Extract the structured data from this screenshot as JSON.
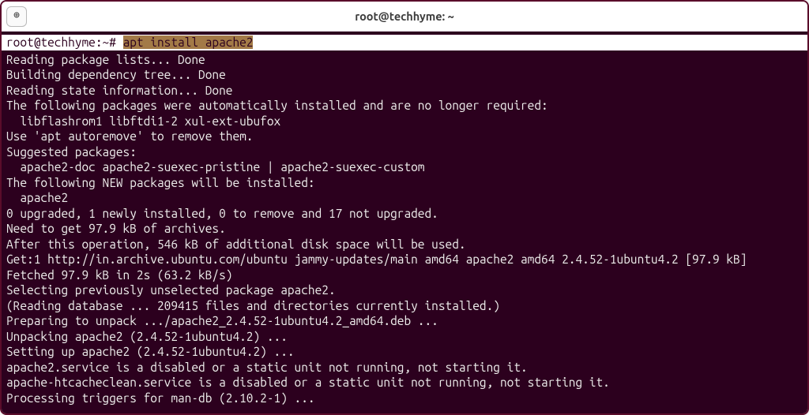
{
  "window": {
    "title": "root@techhyme: ~"
  },
  "titlebar": {
    "new_tab_label": "⊕"
  },
  "terminal": {
    "prompt": "root@techhyme:~# ",
    "command": "apt install apache2",
    "lines": [
      "Reading package lists... Done",
      "Building dependency tree... Done",
      "Reading state information... Done",
      "The following packages were automatically installed and are no longer required:",
      "  libflashrom1 libftdi1-2 xul-ext-ubufox",
      "Use 'apt autoremove' to remove them.",
      "Suggested packages:",
      "  apache2-doc apache2-suexec-pristine | apache2-suexec-custom",
      "The following NEW packages will be installed:",
      "  apache2",
      "0 upgraded, 1 newly installed, 0 to remove and 17 not upgraded.",
      "Need to get 97.9 kB of archives.",
      "After this operation, 546 kB of additional disk space will be used.",
      "Get:1 http://in.archive.ubuntu.com/ubuntu jammy-updates/main amd64 apache2 amd64 2.4.52-1ubuntu4.2 [97.9 kB]",
      "Fetched 97.9 kB in 2s (63.2 kB/s)",
      "Selecting previously unselected package apache2.",
      "(Reading database ... 209415 files and directories currently installed.)",
      "Preparing to unpack .../apache2_2.4.52-1ubuntu4.2_amd64.deb ...",
      "Unpacking apache2 (2.4.52-1ubuntu4.2) ...",
      "Setting up apache2 (2.4.52-1ubuntu4.2) ...",
      "apache2.service is a disabled or a static unit not running, not starting it.",
      "apache-htcacheclean.service is a disabled or a static unit not running, not starting it.",
      "Processing triggers for man-db (2.10.2-1) ..."
    ]
  }
}
